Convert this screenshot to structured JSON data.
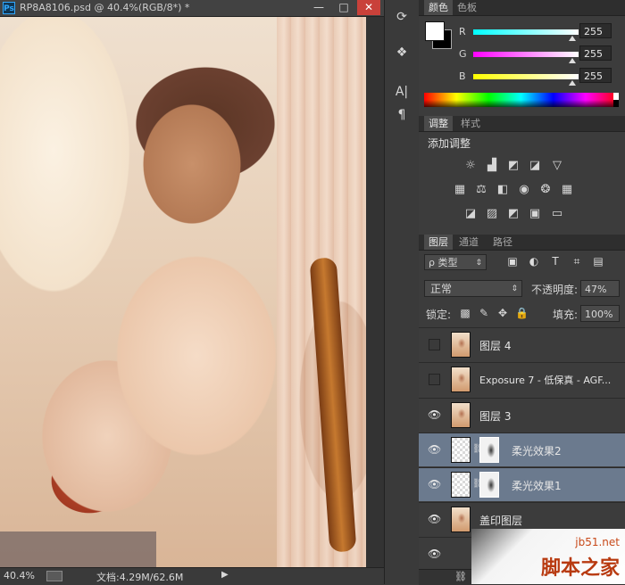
{
  "document": {
    "app_badge": "Ps",
    "title": "RP8A8106.psd @ 40.4%(RGB/8*) *",
    "minimize": "—",
    "restore": "□",
    "close": "✕",
    "zoom": "40.4%",
    "doc_size": "文档:4.29M/62.6M",
    "status_arrow": "▶"
  },
  "tools": [
    {
      "icon": "history-brush-icon",
      "glyph": "⟳"
    },
    {
      "icon": "properties-icon",
      "glyph": "❖"
    },
    {
      "icon": "character-icon",
      "glyph": "A|"
    },
    {
      "icon": "paragraph-icon",
      "glyph": "¶"
    }
  ],
  "color_panel": {
    "tabs": [
      "颜色",
      "色板"
    ],
    "fg_color": "#ffffff",
    "bg_color": "#000000",
    "sliders": [
      {
        "label": "R",
        "value": "255"
      },
      {
        "label": "G",
        "value": "255"
      },
      {
        "label": "B",
        "value": "255"
      }
    ]
  },
  "adjustments_panel": {
    "tabs": [
      "调整",
      "样式"
    ],
    "title": "添加调整",
    "icons": [
      {
        "name": "brightness-icon",
        "glyph": "☼"
      },
      {
        "name": "levels-icon",
        "glyph": "▟"
      },
      {
        "name": "curves-icon",
        "glyph": "◩"
      },
      {
        "name": "exposure-icon",
        "glyph": "◪"
      },
      {
        "name": "vibrance-icon",
        "glyph": "▽"
      },
      {
        "name": "hue-saturation-icon",
        "glyph": "▦"
      },
      {
        "name": "color-balance-icon",
        "glyph": "⚖"
      },
      {
        "name": "black-white-icon",
        "glyph": "◧"
      },
      {
        "name": "photo-filter-icon",
        "glyph": "◉"
      },
      {
        "name": "channel-mixer-icon",
        "glyph": "❂"
      },
      {
        "name": "color-lookup-icon",
        "glyph": "▦"
      },
      {
        "name": "invert-icon",
        "glyph": "◪"
      },
      {
        "name": "posterize-icon",
        "glyph": "▨"
      },
      {
        "name": "threshold-icon",
        "glyph": "◩"
      },
      {
        "name": "selective-color-icon",
        "glyph": "▣"
      },
      {
        "name": "gradient-map-icon",
        "glyph": "▭"
      }
    ]
  },
  "layers_panel": {
    "tabs": [
      "图层",
      "通道",
      "路径"
    ],
    "filter_label": "ρ 类型",
    "filter_caret": "⇕",
    "filter_icons": [
      "▣",
      "◐",
      "T",
      "⌗",
      "▤"
    ],
    "blend_mode": "正常",
    "blend_caret": "⇕",
    "opacity_label": "不透明度:",
    "opacity_value": "47%",
    "lock_label": "锁定:",
    "lock_icons": [
      "▩",
      "✎",
      "✥",
      "🔒"
    ],
    "fill_label": "填充:",
    "fill_value": "100%",
    "layers": [
      {
        "name": "图层 4",
        "visible": false,
        "selected": false,
        "has_mask": false
      },
      {
        "name": "Exposure 7 - 低保真 - AGF...",
        "visible": false,
        "selected": false,
        "has_mask": false
      },
      {
        "name": "图层 3",
        "visible": true,
        "selected": false,
        "has_mask": false
      },
      {
        "name": "柔光效果2",
        "visible": true,
        "selected": true,
        "has_mask": true
      },
      {
        "name": "柔光效果1",
        "visible": true,
        "selected": true,
        "has_mask": true
      },
      {
        "name": "盖印图层",
        "visible": true,
        "selected": false,
        "has_mask": false
      },
      {
        "name": "",
        "visible": true,
        "selected": false,
        "has_mask": false
      }
    ],
    "eye_glyph": "👁",
    "chain_glyph": "⛓",
    "bottom_link_glyph": "⛓"
  },
  "watermark": {
    "site": "jb51.net",
    "brand": "脚本之家"
  }
}
